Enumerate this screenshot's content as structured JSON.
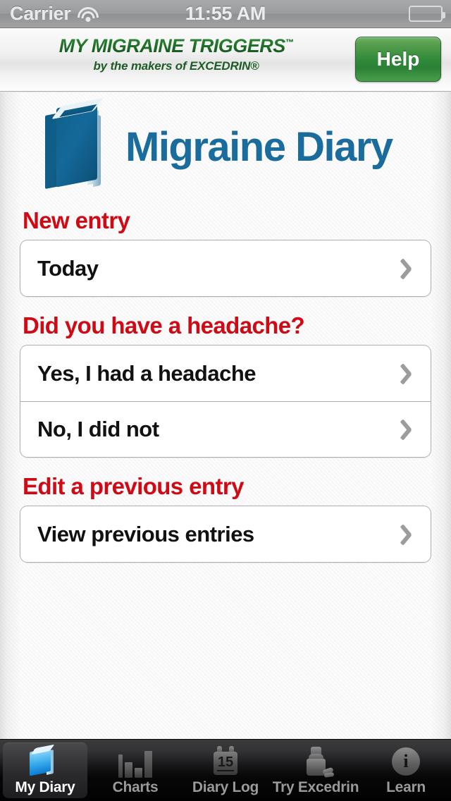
{
  "statusbar": {
    "carrier": "Carrier",
    "time": "11:55 AM",
    "wifi_icon": "wifi-icon",
    "battery_icon": "battery-icon"
  },
  "brand": {
    "title": "MY MIGRAINE TRIGGERS",
    "trademark": "™",
    "subtitle": "by the makers of EXCEDRIN®",
    "help_label": "Help",
    "brand_color": "#1d6b27",
    "help_color": "#2f8a39"
  },
  "header": {
    "app_title": "Migraine Diary",
    "logo_icon": "book-icon",
    "title_color": "#1a6c9c"
  },
  "sections": [
    {
      "label": "New entry",
      "rows": [
        {
          "label": "Today",
          "chevron": "chevron-right-icon"
        }
      ]
    },
    {
      "label": "Did you have a headache?",
      "rows": [
        {
          "label": "Yes, I had a headache",
          "chevron": "chevron-right-icon"
        },
        {
          "label": "No, I did not",
          "chevron": "chevron-right-icon"
        }
      ]
    },
    {
      "label": "Edit a previous entry",
      "rows": [
        {
          "label": "View previous entries",
          "chevron": "chevron-right-icon"
        }
      ]
    }
  ],
  "section_label_color": "#cf0a15",
  "tabbar": {
    "tabs": [
      {
        "label": "My Diary",
        "icon": "book-icon",
        "active": true
      },
      {
        "label": "Charts",
        "icon": "bar-chart-icon",
        "active": false
      },
      {
        "label": "Diary Log",
        "icon": "calendar-icon",
        "active": false
      },
      {
        "label": "Try Excedrin",
        "icon": "pill-bottle-icon",
        "active": false
      },
      {
        "label": "Learn",
        "icon": "info-circle-icon",
        "active": false
      }
    ],
    "calendar_day": "15",
    "info_glyph": "i"
  }
}
